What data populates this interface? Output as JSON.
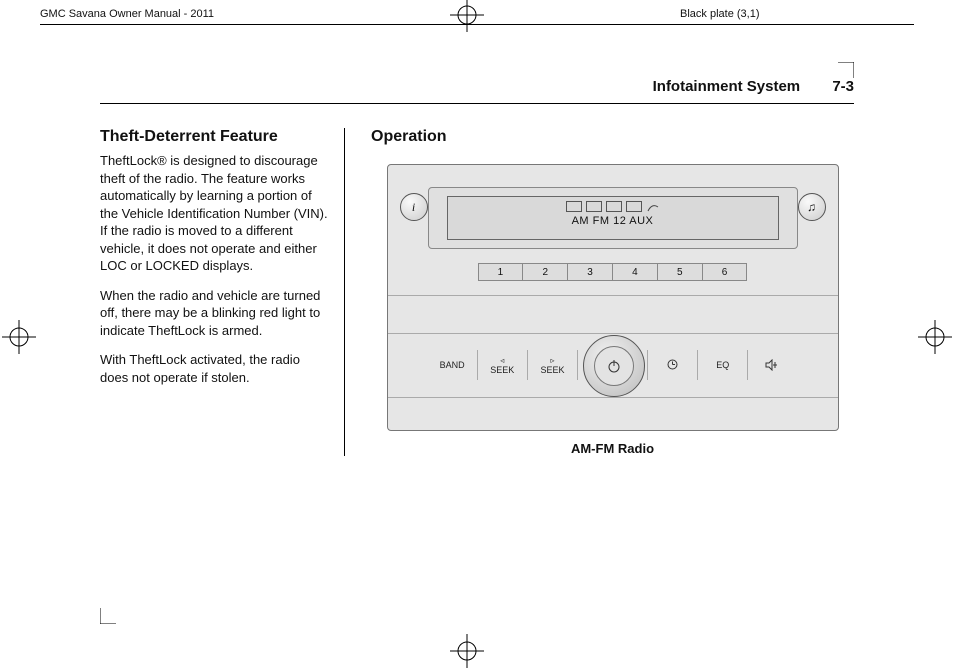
{
  "meta": {
    "manual_title": "GMC Savana Owner Manual - 2011",
    "plate": "Black plate (3,1)"
  },
  "running_head": {
    "chapter": "Infotainment System",
    "page": "7-3"
  },
  "columns": {
    "left": {
      "heading": "Theft-Deterrent Feature",
      "para1": "TheftLock® is designed to discourage theft of the radio. The feature works automatically by learning a portion of the Vehicle Identification Number (VIN). If the radio is moved to a different vehicle, it does not operate and either LOC or LOCKED displays.",
      "para2": "When the radio and vehicle are turned off, there may be a blinking red light to indicate TheftLock is armed.",
      "para3": "With TheftLock activated, the radio does not operate if stolen."
    },
    "right": {
      "heading": "Operation",
      "figure_caption": "AM-FM Radio"
    }
  },
  "radio": {
    "display_line": "AM FM 12 AUX",
    "presets": [
      "1",
      "2",
      "3",
      "4",
      "5",
      "6"
    ],
    "buttons": {
      "band": "BAND",
      "seek_back": "SEEK",
      "seek_fwd": "SEEK",
      "eq": "EQ"
    },
    "icons": {
      "info": "i",
      "category": "♫",
      "power": "power-icon",
      "clock": "clock-icon",
      "speaker": "speaker-icon",
      "seek_back_glyph": "◃",
      "seek_fwd_glyph": "▹"
    }
  }
}
